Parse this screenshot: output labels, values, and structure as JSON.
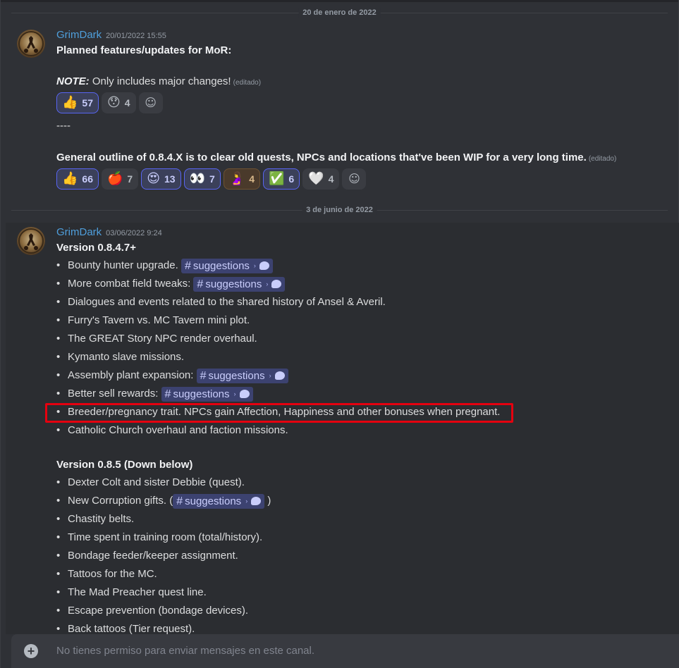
{
  "dividers": [
    "20 de enero de 2022",
    "3 de junio de 2022"
  ],
  "msg1": {
    "author": "GrimDark",
    "timestamp": "20/01/2022 15:55",
    "title": "Planned features/updates for MoR:",
    "note_label": "NOTE:",
    "note_text": " Only includes major changes!",
    "edited": "(editado)",
    "reactions1": [
      {
        "emoji": "👍",
        "count": "57",
        "me": true
      },
      {
        "emoji": "😯",
        "count": "4",
        "me": false
      }
    ],
    "separator": "----",
    "outline": "General outline of 0.8.4.X is to clear old quests, NPCs and locations that've been WIP for a very long time.",
    "edited2": "(editado)",
    "reactions2": [
      {
        "emoji": "👍",
        "count": "66",
        "me": true
      },
      {
        "emoji": "🍎",
        "count": "7",
        "me": false
      },
      {
        "emoji": "😍",
        "count": "13",
        "me": true
      },
      {
        "emoji": "👀",
        "count": "7",
        "me": true
      },
      {
        "emoji": "🤰",
        "count": "4",
        "me": false
      },
      {
        "emoji": "✅",
        "count": "6",
        "me": true
      },
      {
        "emoji": "🤍",
        "count": "4",
        "me": false
      }
    ]
  },
  "msg2": {
    "author": "GrimDark",
    "timestamp": "03/06/2022 9:24",
    "v1_title": "Version 0.8.4.7+",
    "v1_items": [
      "Bounty hunter upgrade. ",
      "More combat field tweaks: ",
      "Dialogues and events related to the shared history of Ansel & Averil.",
      "Furry's Tavern vs. MC Tavern mini plot.",
      "The GREAT Story NPC render overhaul.",
      "Kymanto slave missions.",
      "Assembly plant expansion: ",
      "Better sell rewards: ",
      "Breeder/pregnancy trait. NPCs gain Affection, Happiness and other bonuses when pregnant.",
      "Catholic Church overhaul and faction missions."
    ],
    "v2_title": "Version 0.8.5 (Down below)",
    "v2_items": [
      "Dexter Colt and sister Debbie (quest).",
      "New Corruption gifts. (",
      "Chastity belts.",
      "Time spent in training room (total/history).",
      "Bondage feeder/keeper assignment.",
      "Tattoos for the MC.",
      "The Mad Preacher quest line.",
      "Escape prevention (bondage devices).",
      "Back tattoos (Tier request)."
    ],
    "channel_name": "suggestions",
    "channel_hash": "#",
    "close_paren": " )"
  },
  "composer": {
    "placeholder": "No tienes permiso para enviar mensajes en este canal."
  },
  "colors": {
    "accent": "#5865f2",
    "highlight_box": "#e5000f",
    "author": "#4f9fdc"
  }
}
